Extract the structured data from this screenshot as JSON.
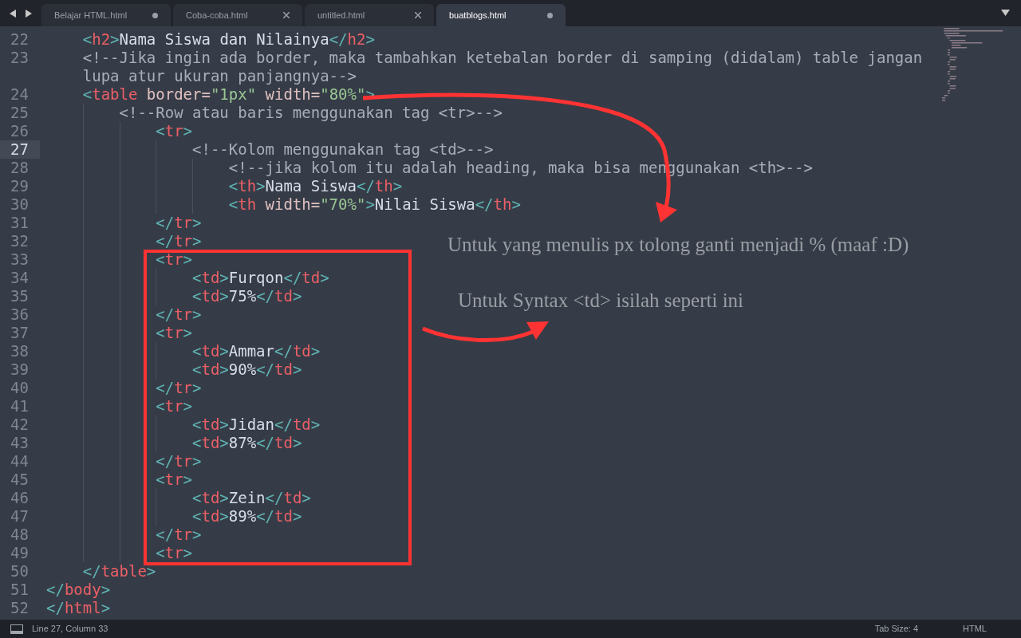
{
  "tabs": [
    {
      "label": "Belajar HTML.html",
      "selected": false,
      "modified": true
    },
    {
      "label": "Coba-coba.html",
      "selected": false,
      "modified": false
    },
    {
      "label": "untitled.html",
      "selected": false,
      "modified": false
    },
    {
      "label": "buatblogs.html",
      "selected": true,
      "modified": true
    }
  ],
  "editor": {
    "lines": [
      {
        "number": "22",
        "current": false,
        "tokens": [
          {
            "kind": "punct",
            "text": "    <"
          },
          {
            "kind": "tag",
            "text": "h2"
          },
          {
            "kind": "punct",
            "text": ">"
          },
          {
            "kind": "text",
            "text": "Nama Siswa dan Nilainya"
          },
          {
            "kind": "punct",
            "text": "</"
          },
          {
            "kind": "tag",
            "text": "h2"
          },
          {
            "kind": "punct",
            "text": ">"
          }
        ]
      },
      {
        "number": "23",
        "current": false,
        "tokens": [
          {
            "kind": "comment",
            "text": "    <!--Jika ingin ada border, maka tambahkan ketebalan border di samping (didalam) table jangan lupa atur ukuran panjangnya-->"
          }
        ]
      },
      {
        "number": "24",
        "current": false,
        "tokens": [
          {
            "kind": "punct",
            "text": "    <"
          },
          {
            "kind": "tag",
            "text": "table"
          },
          {
            "kind": "attr",
            "text": " border="
          },
          {
            "kind": "string",
            "text": "\"1px\""
          },
          {
            "kind": "attr",
            "text": " width="
          },
          {
            "kind": "string",
            "text": "\"80%\""
          },
          {
            "kind": "punct",
            "text": ">"
          }
        ]
      },
      {
        "number": "25",
        "current": false,
        "tokens": [
          {
            "kind": "comment",
            "text": "        <!--Row atau baris menggunakan tag <tr>-->"
          }
        ]
      },
      {
        "number": "26",
        "current": false,
        "tokens": [
          {
            "kind": "punct",
            "text": "            <"
          },
          {
            "kind": "tag",
            "text": "tr"
          },
          {
            "kind": "punct",
            "text": ">"
          }
        ]
      },
      {
        "number": "27",
        "current": true,
        "tokens": [
          {
            "kind": "comment",
            "text": "                <!--Kolom menggunakan tag <td>-->"
          }
        ]
      },
      {
        "number": "28",
        "current": false,
        "tokens": [
          {
            "kind": "comment",
            "text": "                    <!--jika kolom itu adalah heading, maka bisa menggunakan <th>-->"
          }
        ]
      },
      {
        "number": "29",
        "current": false,
        "tokens": [
          {
            "kind": "punct",
            "text": "                    <"
          },
          {
            "kind": "tag",
            "text": "th"
          },
          {
            "kind": "punct",
            "text": ">"
          },
          {
            "kind": "text",
            "text": "Nama Siswa"
          },
          {
            "kind": "punct",
            "text": "</"
          },
          {
            "kind": "tag",
            "text": "th"
          },
          {
            "kind": "punct",
            "text": ">"
          }
        ]
      },
      {
        "number": "30",
        "current": false,
        "tokens": [
          {
            "kind": "punct",
            "text": "                    <"
          },
          {
            "kind": "tag",
            "text": "th"
          },
          {
            "kind": "attr",
            "text": " width="
          },
          {
            "kind": "string",
            "text": "\"70%\""
          },
          {
            "kind": "punct",
            "text": ">"
          },
          {
            "kind": "text",
            "text": "Nilai Siswa"
          },
          {
            "kind": "punct",
            "text": "</"
          },
          {
            "kind": "tag",
            "text": "th"
          },
          {
            "kind": "punct",
            "text": ">"
          }
        ]
      },
      {
        "number": "31",
        "current": false,
        "tokens": [
          {
            "kind": "punct",
            "text": "            </"
          },
          {
            "kind": "tag",
            "text": "tr"
          },
          {
            "kind": "punct",
            "text": ">"
          }
        ]
      },
      {
        "number": "32",
        "current": false,
        "tokens": [
          {
            "kind": "punct",
            "text": "            </"
          },
          {
            "kind": "tag",
            "text": "tr"
          },
          {
            "kind": "punct",
            "text": ">"
          }
        ]
      },
      {
        "number": "33",
        "current": false,
        "tokens": [
          {
            "kind": "punct",
            "text": "            <"
          },
          {
            "kind": "tag",
            "text": "tr"
          },
          {
            "kind": "punct",
            "text": ">"
          }
        ]
      },
      {
        "number": "34",
        "current": false,
        "tokens": [
          {
            "kind": "punct",
            "text": "                <"
          },
          {
            "kind": "tag",
            "text": "td"
          },
          {
            "kind": "punct",
            "text": ">"
          },
          {
            "kind": "text",
            "text": "Furqon"
          },
          {
            "kind": "punct",
            "text": "</"
          },
          {
            "kind": "tag",
            "text": "td"
          },
          {
            "kind": "punct",
            "text": ">"
          }
        ]
      },
      {
        "number": "35",
        "current": false,
        "tokens": [
          {
            "kind": "punct",
            "text": "                <"
          },
          {
            "kind": "tag",
            "text": "td"
          },
          {
            "kind": "punct",
            "text": ">"
          },
          {
            "kind": "text",
            "text": "75%"
          },
          {
            "kind": "punct",
            "text": "</"
          },
          {
            "kind": "tag",
            "text": "td"
          },
          {
            "kind": "punct",
            "text": ">"
          }
        ]
      },
      {
        "number": "36",
        "current": false,
        "tokens": [
          {
            "kind": "punct",
            "text": "            </"
          },
          {
            "kind": "tag",
            "text": "tr"
          },
          {
            "kind": "punct",
            "text": ">"
          }
        ]
      },
      {
        "number": "37",
        "current": false,
        "tokens": [
          {
            "kind": "punct",
            "text": "            <"
          },
          {
            "kind": "tag",
            "text": "tr"
          },
          {
            "kind": "punct",
            "text": ">"
          }
        ]
      },
      {
        "number": "38",
        "current": false,
        "tokens": [
          {
            "kind": "punct",
            "text": "                <"
          },
          {
            "kind": "tag",
            "text": "td"
          },
          {
            "kind": "punct",
            "text": ">"
          },
          {
            "kind": "text",
            "text": "Ammar"
          },
          {
            "kind": "punct",
            "text": "</"
          },
          {
            "kind": "tag",
            "text": "td"
          },
          {
            "kind": "punct",
            "text": ">"
          }
        ]
      },
      {
        "number": "39",
        "current": false,
        "tokens": [
          {
            "kind": "punct",
            "text": "                <"
          },
          {
            "kind": "tag",
            "text": "td"
          },
          {
            "kind": "punct",
            "text": ">"
          },
          {
            "kind": "text",
            "text": "90%"
          },
          {
            "kind": "punct",
            "text": "</"
          },
          {
            "kind": "tag",
            "text": "td"
          },
          {
            "kind": "punct",
            "text": ">"
          }
        ]
      },
      {
        "number": "40",
        "current": false,
        "tokens": [
          {
            "kind": "punct",
            "text": "            </"
          },
          {
            "kind": "tag",
            "text": "tr"
          },
          {
            "kind": "punct",
            "text": ">"
          }
        ]
      },
      {
        "number": "41",
        "current": false,
        "tokens": [
          {
            "kind": "punct",
            "text": "            <"
          },
          {
            "kind": "tag",
            "text": "tr"
          },
          {
            "kind": "punct",
            "text": ">"
          }
        ]
      },
      {
        "number": "42",
        "current": false,
        "tokens": [
          {
            "kind": "punct",
            "text": "                <"
          },
          {
            "kind": "tag",
            "text": "td"
          },
          {
            "kind": "punct",
            "text": ">"
          },
          {
            "kind": "text",
            "text": "Jidan"
          },
          {
            "kind": "punct",
            "text": "</"
          },
          {
            "kind": "tag",
            "text": "td"
          },
          {
            "kind": "punct",
            "text": ">"
          }
        ]
      },
      {
        "number": "43",
        "current": false,
        "tokens": [
          {
            "kind": "punct",
            "text": "                <"
          },
          {
            "kind": "tag",
            "text": "td"
          },
          {
            "kind": "punct",
            "text": ">"
          },
          {
            "kind": "text",
            "text": "87%"
          },
          {
            "kind": "punct",
            "text": "</"
          },
          {
            "kind": "tag",
            "text": "td"
          },
          {
            "kind": "punct",
            "text": ">"
          }
        ]
      },
      {
        "number": "44",
        "current": false,
        "tokens": [
          {
            "kind": "punct",
            "text": "            </"
          },
          {
            "kind": "tag",
            "text": "tr"
          },
          {
            "kind": "punct",
            "text": ">"
          }
        ]
      },
      {
        "number": "45",
        "current": false,
        "tokens": [
          {
            "kind": "punct",
            "text": "            <"
          },
          {
            "kind": "tag",
            "text": "tr"
          },
          {
            "kind": "punct",
            "text": ">"
          }
        ]
      },
      {
        "number": "46",
        "current": false,
        "tokens": [
          {
            "kind": "punct",
            "text": "                <"
          },
          {
            "kind": "tag",
            "text": "td"
          },
          {
            "kind": "punct",
            "text": ">"
          },
          {
            "kind": "text",
            "text": "Zein"
          },
          {
            "kind": "punct",
            "text": "</"
          },
          {
            "kind": "tag",
            "text": "td"
          },
          {
            "kind": "punct",
            "text": ">"
          }
        ]
      },
      {
        "number": "47",
        "current": false,
        "tokens": [
          {
            "kind": "punct",
            "text": "                <"
          },
          {
            "kind": "tag",
            "text": "td"
          },
          {
            "kind": "punct",
            "text": ">"
          },
          {
            "kind": "text",
            "text": "89%"
          },
          {
            "kind": "punct",
            "text": "</"
          },
          {
            "kind": "tag",
            "text": "td"
          },
          {
            "kind": "punct",
            "text": ">"
          }
        ]
      },
      {
        "number": "48",
        "current": false,
        "tokens": [
          {
            "kind": "punct",
            "text": "            </"
          },
          {
            "kind": "tag",
            "text": "tr"
          },
          {
            "kind": "punct",
            "text": ">"
          }
        ]
      },
      {
        "number": "49",
        "current": false,
        "tokens": [
          {
            "kind": "punct",
            "text": "            <"
          },
          {
            "kind": "tag",
            "text": "tr"
          },
          {
            "kind": "punct",
            "text": ">"
          }
        ]
      },
      {
        "number": "50",
        "current": false,
        "tokens": [
          {
            "kind": "punct",
            "text": "    </"
          },
          {
            "kind": "tag",
            "text": "table"
          },
          {
            "kind": "punct",
            "text": ">"
          }
        ]
      },
      {
        "number": "51",
        "current": false,
        "tokens": [
          {
            "kind": "punct",
            "text": "</"
          },
          {
            "kind": "tag",
            "text": "body"
          },
          {
            "kind": "punct",
            "text": ">"
          }
        ]
      },
      {
        "number": "52",
        "current": false,
        "tokens": [
          {
            "kind": "punct",
            "text": "</"
          },
          {
            "kind": "tag",
            "text": "html"
          },
          {
            "kind": "punct",
            "text": ">"
          }
        ]
      }
    ]
  },
  "annotations": [
    {
      "text": "Untuk yang menulis px tolong ganti menjadi % (maaf :D)"
    },
    {
      "text": "Untuk Syntax <td> isilah seperti ini"
    }
  ],
  "status_bar": {
    "position": "Line 27, Column 33",
    "tab_size": "Tab Size: 4",
    "syntax": "HTML"
  }
}
